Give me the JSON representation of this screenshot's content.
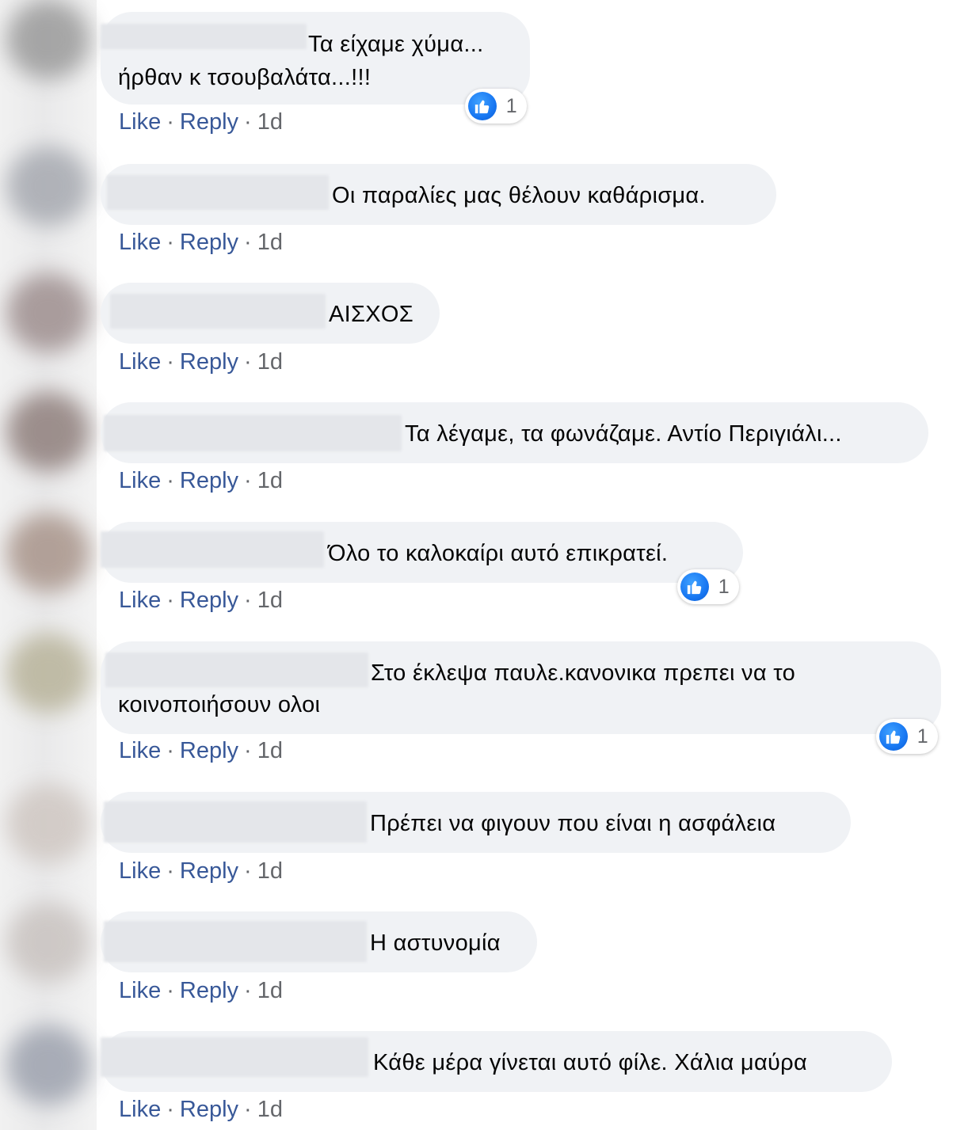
{
  "actions": {
    "like": "Like",
    "reply": "Reply",
    "separator": "·",
    "time": "1d"
  },
  "colors": {
    "bubble": "#f0f2f5",
    "link": "#385898",
    "meta": "#65676b",
    "like_blue": "#1877f2"
  },
  "comments": [
    {
      "line1": "Τα είχαμε χύμα...",
      "line2": "ήρθαν κ τσουβαλάτα...!!!",
      "reactions": "1"
    },
    {
      "line1": "Οι παραλίες μας θέλουν καθάρισμα."
    },
    {
      "line1": "ΑΙΣΧΟΣ"
    },
    {
      "line1": "Τα λέγαμε, τα φωνάζαμε. Αντίο Περιγιάλι..."
    },
    {
      "line1": "Όλο το καλοκαίρι αυτό επικρατεί.",
      "reactions": "1"
    },
    {
      "line1": "Στο έκλεψα παυλε.κανονικα πρεπει να το",
      "line2": "κοινοποιήσουν ολοι",
      "reactions": "1"
    },
    {
      "line1": "Πρέπει να φιγουν που είναι η ασφάλεια"
    },
    {
      "line1": "Η αστυνομία"
    },
    {
      "line1": "Κάθε μέρα γίνεται αυτό φίλε. Χάλια μαύρα"
    }
  ]
}
